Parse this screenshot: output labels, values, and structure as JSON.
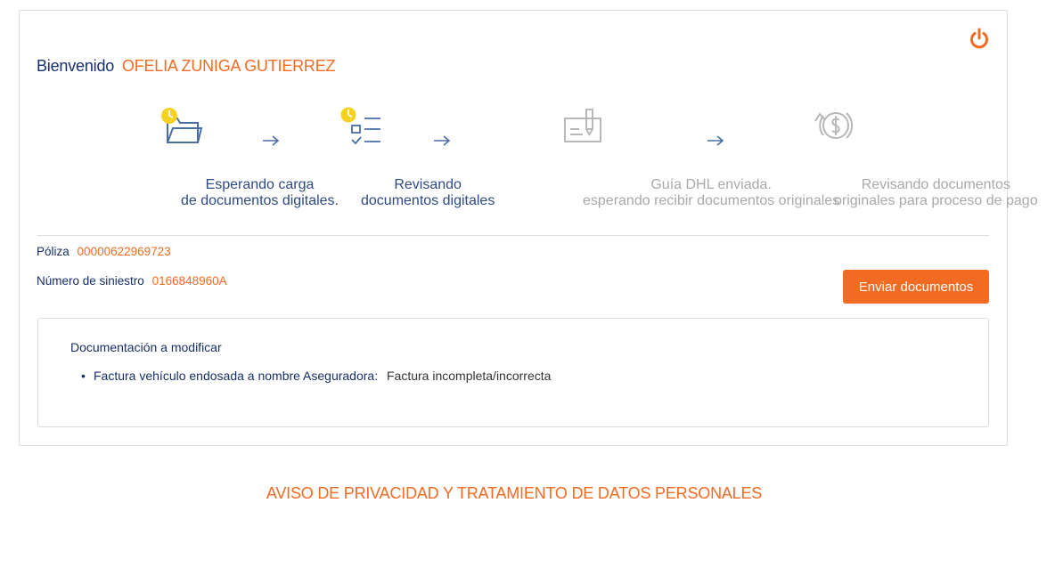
{
  "header": {
    "welcome_label": "Bienvenido",
    "user_name": "OFELIA ZUNIGA GUTIERREZ",
    "logout_icon": "power-icon"
  },
  "steps": [
    {
      "icon": "folder-clock-icon",
      "caption_line1": "Esperando carga",
      "caption_line2": "de documentos digitales.",
      "status": "active",
      "color": "#4a6ea6"
    },
    {
      "icon": "checklist-clock-icon",
      "caption_line1": "Revisando",
      "caption_line2": "documentos digitales",
      "status": "active",
      "color": "#4a6ea6"
    },
    {
      "icon": "document-signature-icon",
      "caption_line1": "Guía DHL enviada.",
      "caption_line2": "esperando recibir documentos originales",
      "status": "pending",
      "color": "#f26b22"
    },
    {
      "icon": "money-refresh-icon",
      "caption_line1": "Revisando documentos",
      "caption_line2": "originales para proceso de pago",
      "status": "pending",
      "color": "#f26b22"
    }
  ],
  "policy": {
    "label": "Póliza",
    "value": "00000622969723"
  },
  "claim": {
    "label": "Número de siniestro",
    "value": "0166848960A"
  },
  "send_button": {
    "label": "Enviar documentos"
  },
  "documents": {
    "title": "Documentación a modificar",
    "items": [
      {
        "name": "Factura vehículo endosada a nombre Aseguradora:",
        "status": "Factura incompleta/incorrecta"
      }
    ]
  },
  "footer": {
    "privacy_link": "AVISO DE PRIVACIDAD Y TRATAMIENTO DE DATOS PERSONALES"
  },
  "colors": {
    "accent": "#f26b22",
    "primary": "#16306a",
    "step_blue": "#4a6ea6",
    "clock_yellow": "#f5d21f",
    "inactive": "#a9a9a9"
  }
}
